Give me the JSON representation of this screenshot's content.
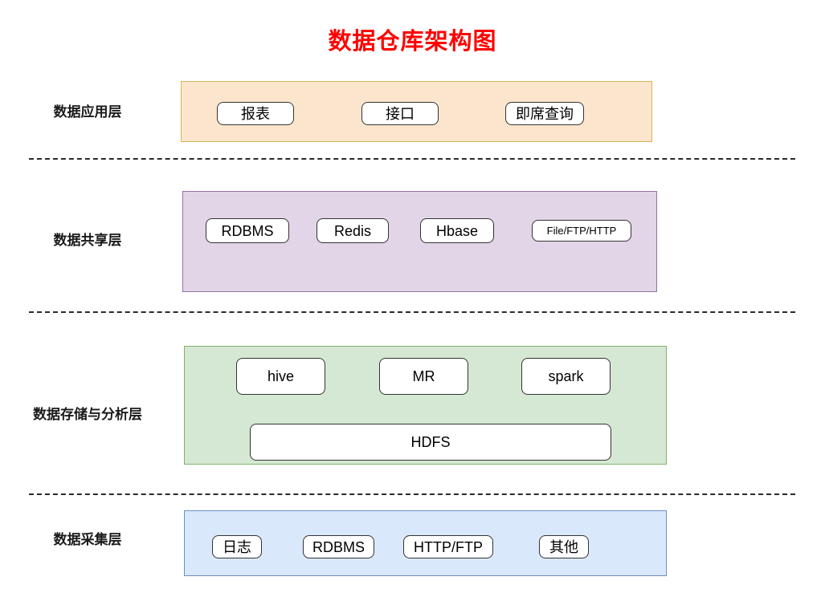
{
  "title": "数据仓库架构图",
  "colors": {
    "title": "#ff0000",
    "application_fill": "#fce5cd",
    "application_stroke": "#d6b656",
    "share_fill": "#e1d5e7",
    "share_stroke": "#9673a6",
    "storage_fill": "#d5e8d4",
    "storage_stroke": "#82b366",
    "ingest_fill": "#dae8fc",
    "ingest_stroke": "#6c8ebf",
    "node_fill": "#ffffff",
    "node_stroke": "#333333",
    "separator": "#2b2b2b"
  },
  "layers": [
    {
      "label": "数据应用层",
      "nodes": [
        {
          "label": "报表"
        },
        {
          "label": "接口"
        },
        {
          "label": "即席查询"
        }
      ]
    },
    {
      "label": "数据共享层",
      "nodes": [
        {
          "label": "RDBMS"
        },
        {
          "label": "Redis"
        },
        {
          "label": "Hbase"
        },
        {
          "label": "File/FTP/HTTP"
        }
      ]
    },
    {
      "label": "数据存储与分析层",
      "nodes": [
        {
          "label": "hive"
        },
        {
          "label": "MR"
        },
        {
          "label": "spark"
        },
        {
          "label": "HDFS"
        }
      ]
    },
    {
      "label": "数据采集层",
      "nodes": [
        {
          "label": "日志"
        },
        {
          "label": "RDBMS"
        },
        {
          "label": "HTTP/FTP"
        },
        {
          "label": "其他"
        }
      ]
    }
  ]
}
